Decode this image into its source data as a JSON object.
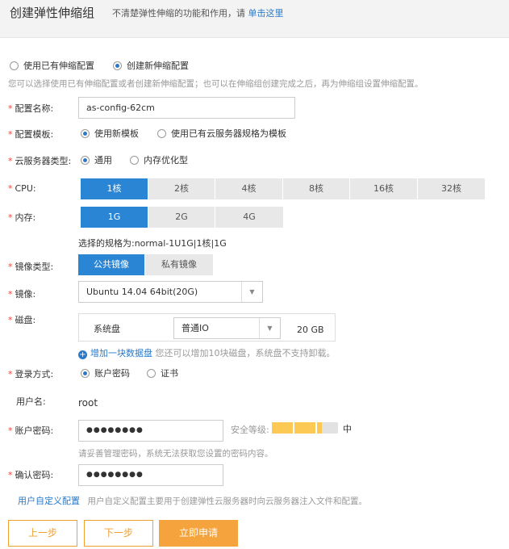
{
  "header": {
    "title": "创建弹性伸缩组",
    "hint_prefix": "不清楚弹性伸缩的功能和作用，请",
    "hint_link": "单击这里"
  },
  "config_mode": {
    "options": [
      "使用已有伸缩配置",
      "创建新伸缩配置"
    ],
    "selected": 1,
    "description": "您可以选择使用已有伸缩配置或者创建新伸缩配置；也可以在伸缩组创建完成之后，再为伸缩组设置伸缩配置。"
  },
  "config_name": {
    "label": "配置名称:",
    "value": "as-config-62cm"
  },
  "config_template": {
    "label": "配置模板:",
    "options": [
      "使用新模板",
      "使用已有云服务器规格为模板"
    ],
    "selected": 0
  },
  "server_type": {
    "label": "云服务器类型:",
    "options": [
      "通用",
      "内存优化型"
    ],
    "selected": 0
  },
  "cpu": {
    "label": "CPU:",
    "options": [
      "1核",
      "2核",
      "4核",
      "8核",
      "16核",
      "32核"
    ],
    "selected": 0
  },
  "memory": {
    "label": "内存:",
    "options": [
      "1G",
      "2G",
      "4G"
    ],
    "selected": 0
  },
  "spec_text": "选择的规格为:normal-1U1G|1核|1G",
  "image_type": {
    "label": "镜像类型:",
    "options": [
      "公共镜像",
      "私有镜像"
    ],
    "selected": 0
  },
  "image": {
    "label": "镜像:",
    "value": "Ubuntu 14.04 64bit(20G)"
  },
  "disk": {
    "label": "磁盘:",
    "name": "系统盘",
    "type": "普通IO",
    "size": "20 GB",
    "add_link": "增加一块数据盘",
    "add_hint": "您还可以增加10块磁盘，系统盘不支持卸载。"
  },
  "login": {
    "label": "登录方式:",
    "options": [
      "账户密码",
      "证书"
    ],
    "selected": 0
  },
  "username": {
    "label": "用户名:",
    "value": "root"
  },
  "password": {
    "label": "账户密码:",
    "value": "●●●●●●●●",
    "strength_label": "安全等级:",
    "strength_text": "中",
    "strength_level": 0.75,
    "hint": "请妥善管理密码，系统无法获取您设置的密码内容。"
  },
  "confirm_password": {
    "label": "确认密码:",
    "value": "●●●●●●●●"
  },
  "user_config": {
    "link": "用户自定义配置",
    "hint": "用户自定义配置主要用于创建弹性云服务器时向云服务器注入文件和配置。"
  },
  "footer": {
    "prev": "上一步",
    "next": "下一步",
    "submit": "立即申请"
  },
  "colors": {
    "accent": "#2a86d5",
    "link": "#2a7ac9",
    "warn": "#f5a33c",
    "required": "#e84c3d",
    "strength": "#fcca54"
  }
}
